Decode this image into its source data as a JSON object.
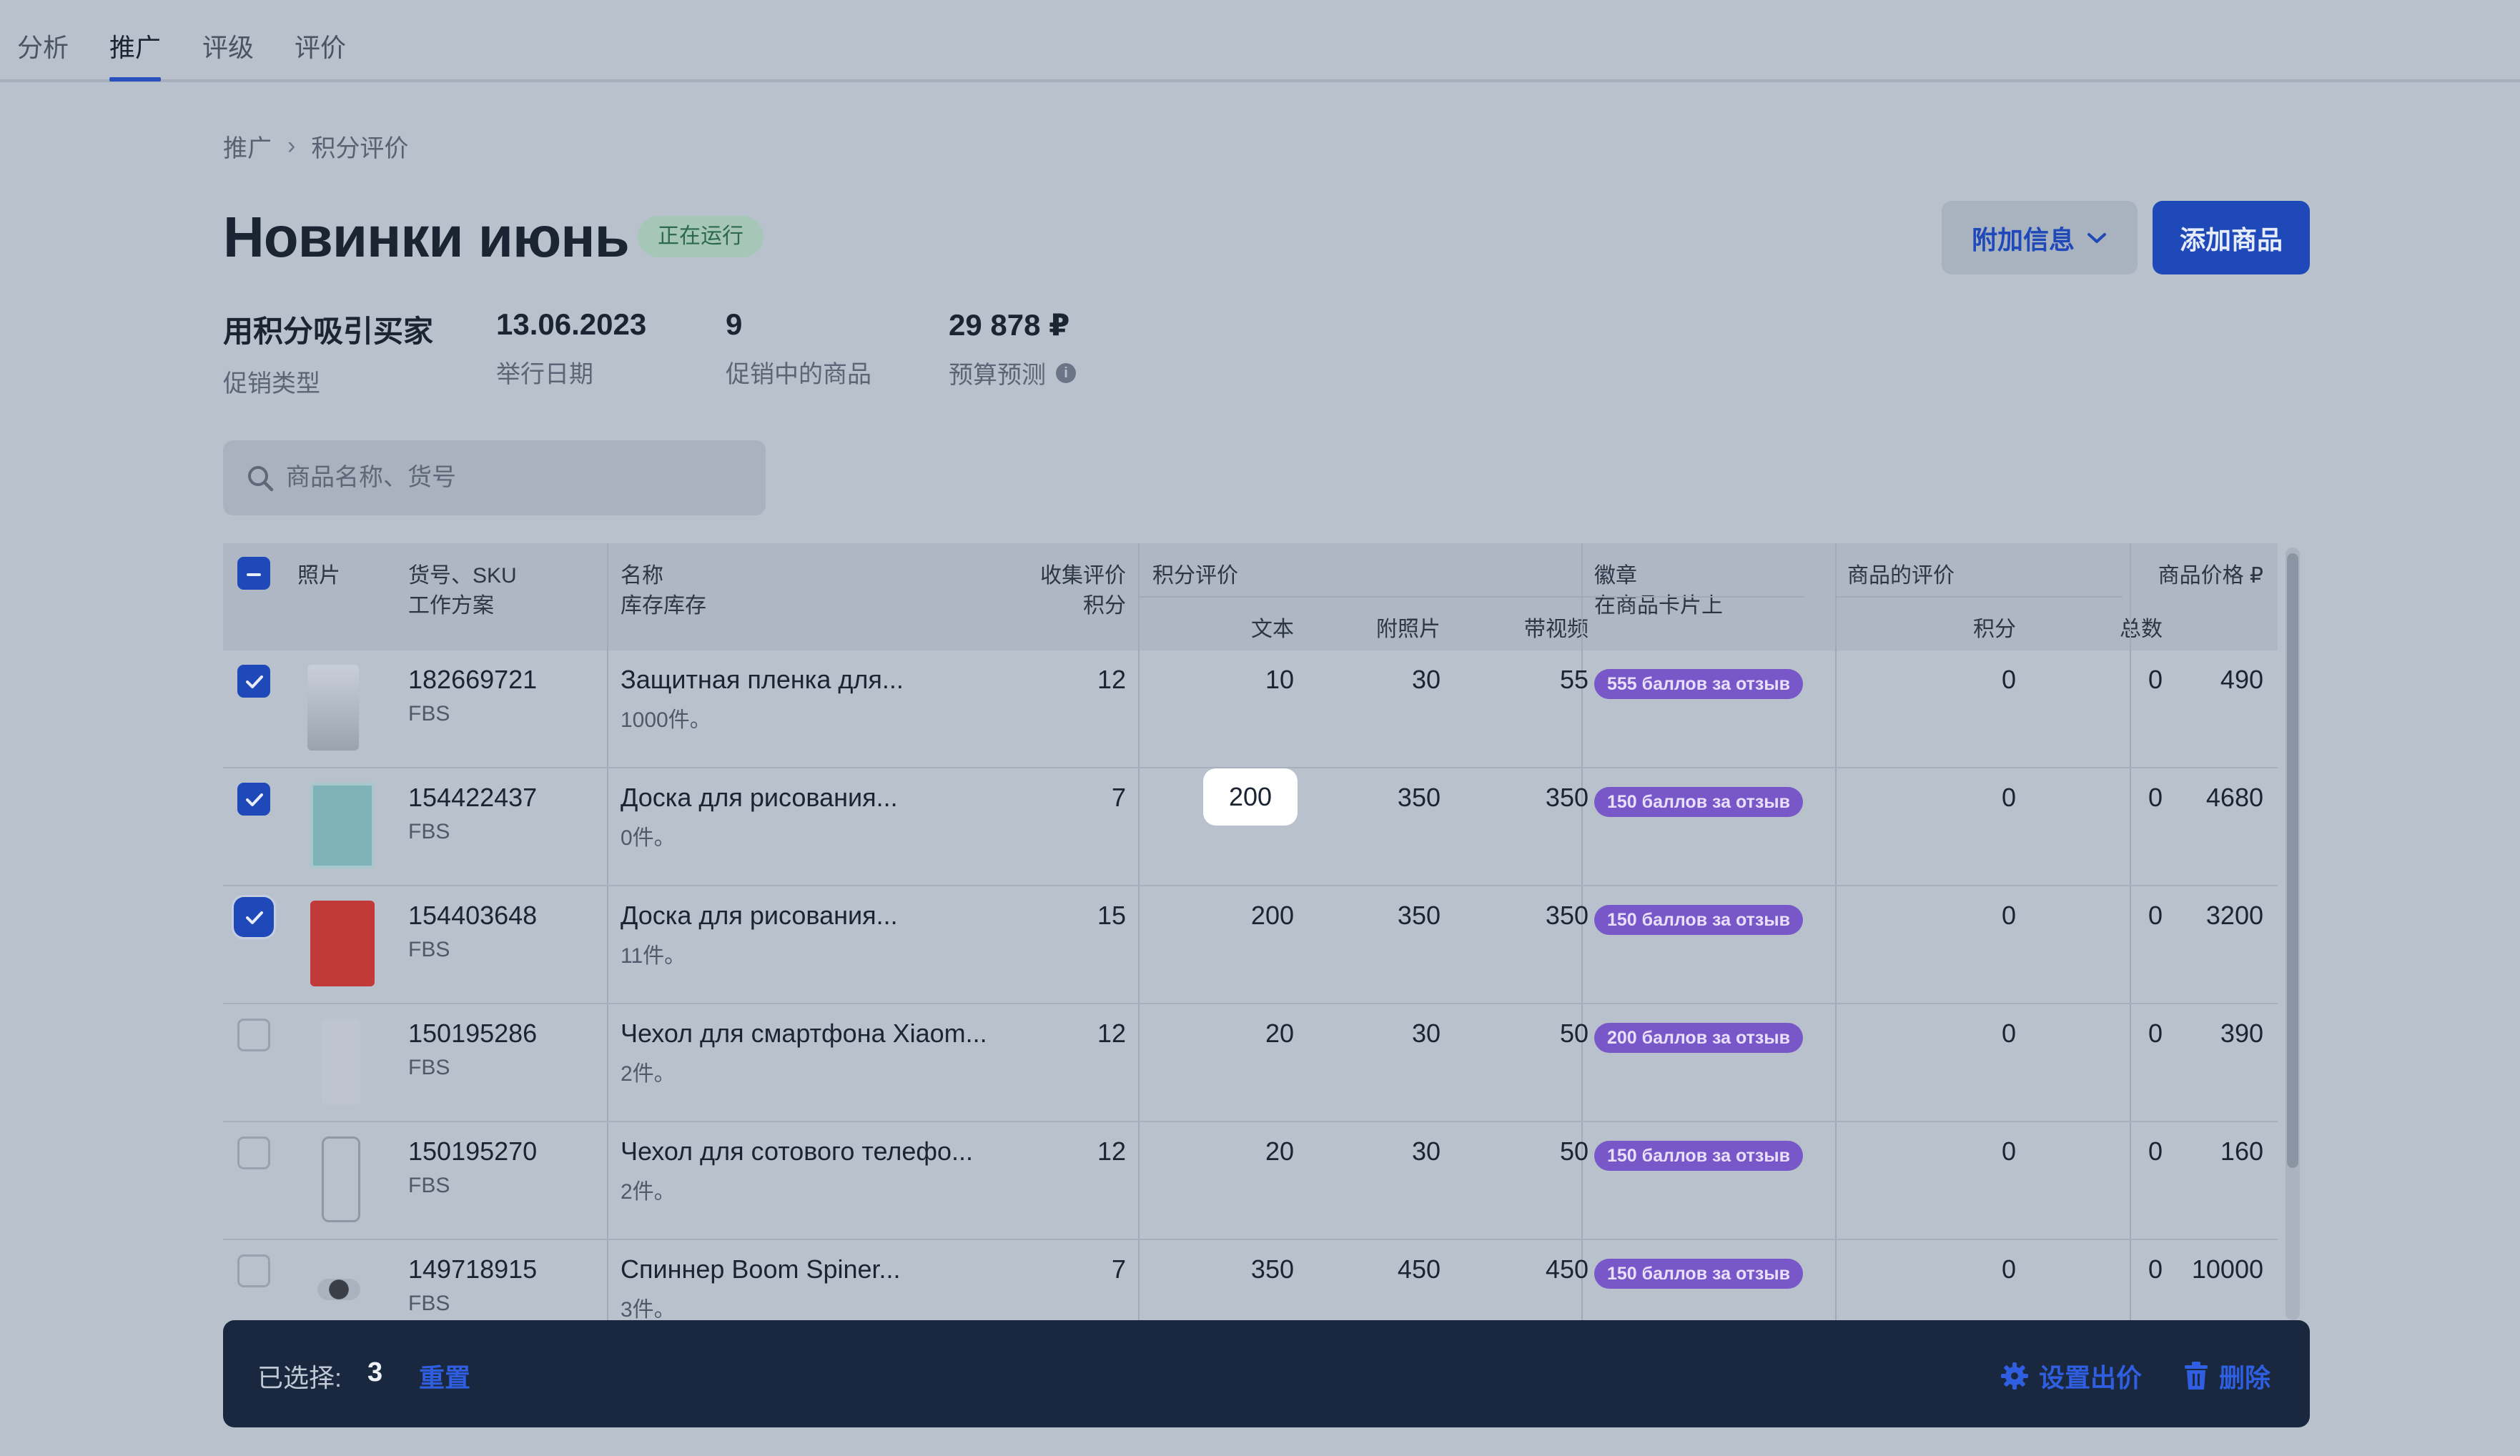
{
  "nav": {
    "tabs": [
      {
        "label": "分析"
      },
      {
        "label": "推广"
      },
      {
        "label": "评级"
      },
      {
        "label": "评价"
      }
    ],
    "active_tab": 1
  },
  "breadcrumb": {
    "parent": "推广",
    "current": "积分评价"
  },
  "page": {
    "title": "Новинки июнь",
    "status": "正在运行",
    "extra_button": "附加信息",
    "add_button": "添加商品"
  },
  "stats": [
    {
      "value": "用积分吸引买家",
      "label": "促销类型"
    },
    {
      "value": "13.06.2023",
      "label": "举行日期"
    },
    {
      "value": "9",
      "label": "促销中的商品"
    },
    {
      "value": "29 878 ₽",
      "label": "预算预测"
    }
  ],
  "search": {
    "placeholder": "商品名称、货号"
  },
  "table": {
    "headers": {
      "photo": "照片",
      "sku": "货号、SKU",
      "scheme": "工作方案",
      "name": "名称",
      "stock": "库存库存",
      "collect": "收集评价",
      "collect_sub": "积分",
      "points_review": "积分评价",
      "text": "文本",
      "photo_att": "附照片",
      "video": "带视频",
      "badge": "徽章",
      "badge_sub": "在商品卡片上",
      "product_reviews": "商品的评价",
      "points": "积分",
      "total": "总数",
      "price": "商品价格 ₽"
    },
    "rows": [
      {
        "checked": true,
        "sku": "182669721",
        "scheme": "FBS",
        "name": "Защитная пленка для...",
        "stock": "1000件。",
        "collect": "12",
        "text": "10",
        "photo": "30",
        "video": "55",
        "badge": "555 баллов за отзыв",
        "rpoints": "0",
        "rtotal": "0",
        "price": "490",
        "thumb": "film"
      },
      {
        "checked": true,
        "sku": "154422437",
        "scheme": "FBS",
        "name": "Доска для рисования...",
        "stock": "0件。",
        "collect": "7",
        "text": "200",
        "photo": "350",
        "video": "350",
        "badge": "150 баллов за отзыв",
        "rpoints": "0",
        "rtotal": "0",
        "price": "4680",
        "thumb": "teal-board"
      },
      {
        "checked": true,
        "sku": "154403648",
        "scheme": "FBS",
        "name": "Доска для рисования...",
        "stock": "11件。",
        "collect": "15",
        "text": "200",
        "photo": "350",
        "video": "350",
        "badge": "150 баллов за отзыв",
        "rpoints": "0",
        "rtotal": "0",
        "price": "3200",
        "thumb": "red-board"
      },
      {
        "checked": false,
        "sku": "150195286",
        "scheme": "FBS",
        "name": "Чехол для смартфона Xiaom...",
        "stock": "2件。",
        "collect": "12",
        "text": "20",
        "photo": "30",
        "video": "50",
        "badge": "200 баллов за отзыв",
        "rpoints": "0",
        "rtotal": "0",
        "price": "390",
        "thumb": "case"
      },
      {
        "checked": false,
        "sku": "150195270",
        "scheme": "FBS",
        "name": "Чехол для сотового телефо...",
        "stock": "2件。",
        "collect": "12",
        "text": "20",
        "photo": "30",
        "video": "50",
        "badge": "150 баллов за отзыв",
        "rpoints": "0",
        "rtotal": "0",
        "price": "160",
        "thumb": "case-outline"
      },
      {
        "checked": false,
        "sku": "149718915",
        "scheme": "FBS",
        "name": "Спиннер Boom Spiner...",
        "stock": "3件。",
        "collect": "7",
        "text": "350",
        "photo": "450",
        "video": "450",
        "badge": "150 баллов за отзыв",
        "rpoints": "0",
        "rtotal": "0",
        "price": "10000",
        "thumb": "spinner"
      }
    ],
    "editing_cell": {
      "row": 1,
      "field": "text"
    }
  },
  "bottom_bar": {
    "selected_label": "已选择:",
    "selected_count": "3",
    "reset": "重置",
    "set_bid": "设置出价",
    "delete": "删除"
  },
  "colors": {
    "accent": "#1f48b8",
    "badge": "#7857c9",
    "status_bg": "#a6c6b7",
    "bottom_bar": "#19283e"
  }
}
